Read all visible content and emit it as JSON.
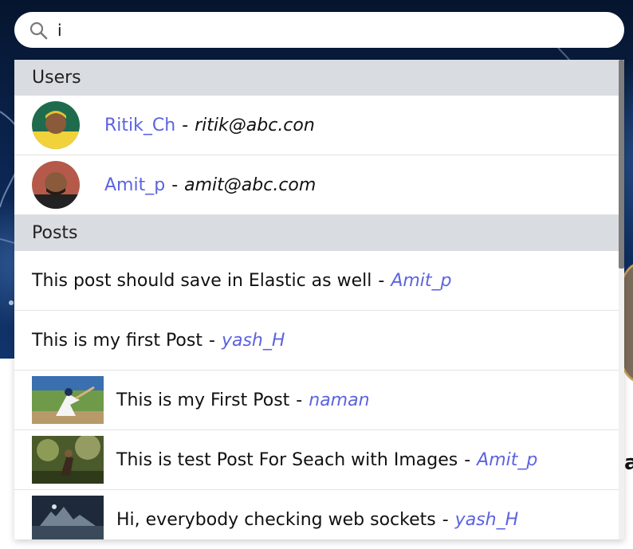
{
  "search": {
    "value": "i",
    "icon": "search-icon"
  },
  "colors": {
    "accent": "#5c63e0",
    "header_bg": "#d9dce0",
    "background_top": "#0b2550"
  },
  "background": {
    "partial_letter": "a"
  },
  "users": {
    "header": "Users",
    "items": [
      {
        "username": "Ritik_Ch",
        "separator": "-",
        "email": "ritik@abc.con",
        "avatar": "avatar-photo"
      },
      {
        "username": "Amit_p",
        "separator": "-",
        "email": "amit@abc.com",
        "avatar": "avatar-photo"
      }
    ]
  },
  "posts": {
    "header": "Posts",
    "items": [
      {
        "text": "This post should save in Elastic as well",
        "separator": "-",
        "author": "Amit_p",
        "has_image": false
      },
      {
        "text": "This is my first Post",
        "separator": "-",
        "author": "yash_H",
        "has_image": false
      },
      {
        "text": "This is my First Post",
        "separator": "-",
        "author": "naman",
        "has_image": true
      },
      {
        "text": "This is test Post For Seach with Images",
        "separator": "-",
        "author": "Amit_p",
        "has_image": true
      },
      {
        "text": "Hi, everybody checking web sockets",
        "separator": "-",
        "author": "yash_H",
        "has_image": true
      }
    ]
  }
}
